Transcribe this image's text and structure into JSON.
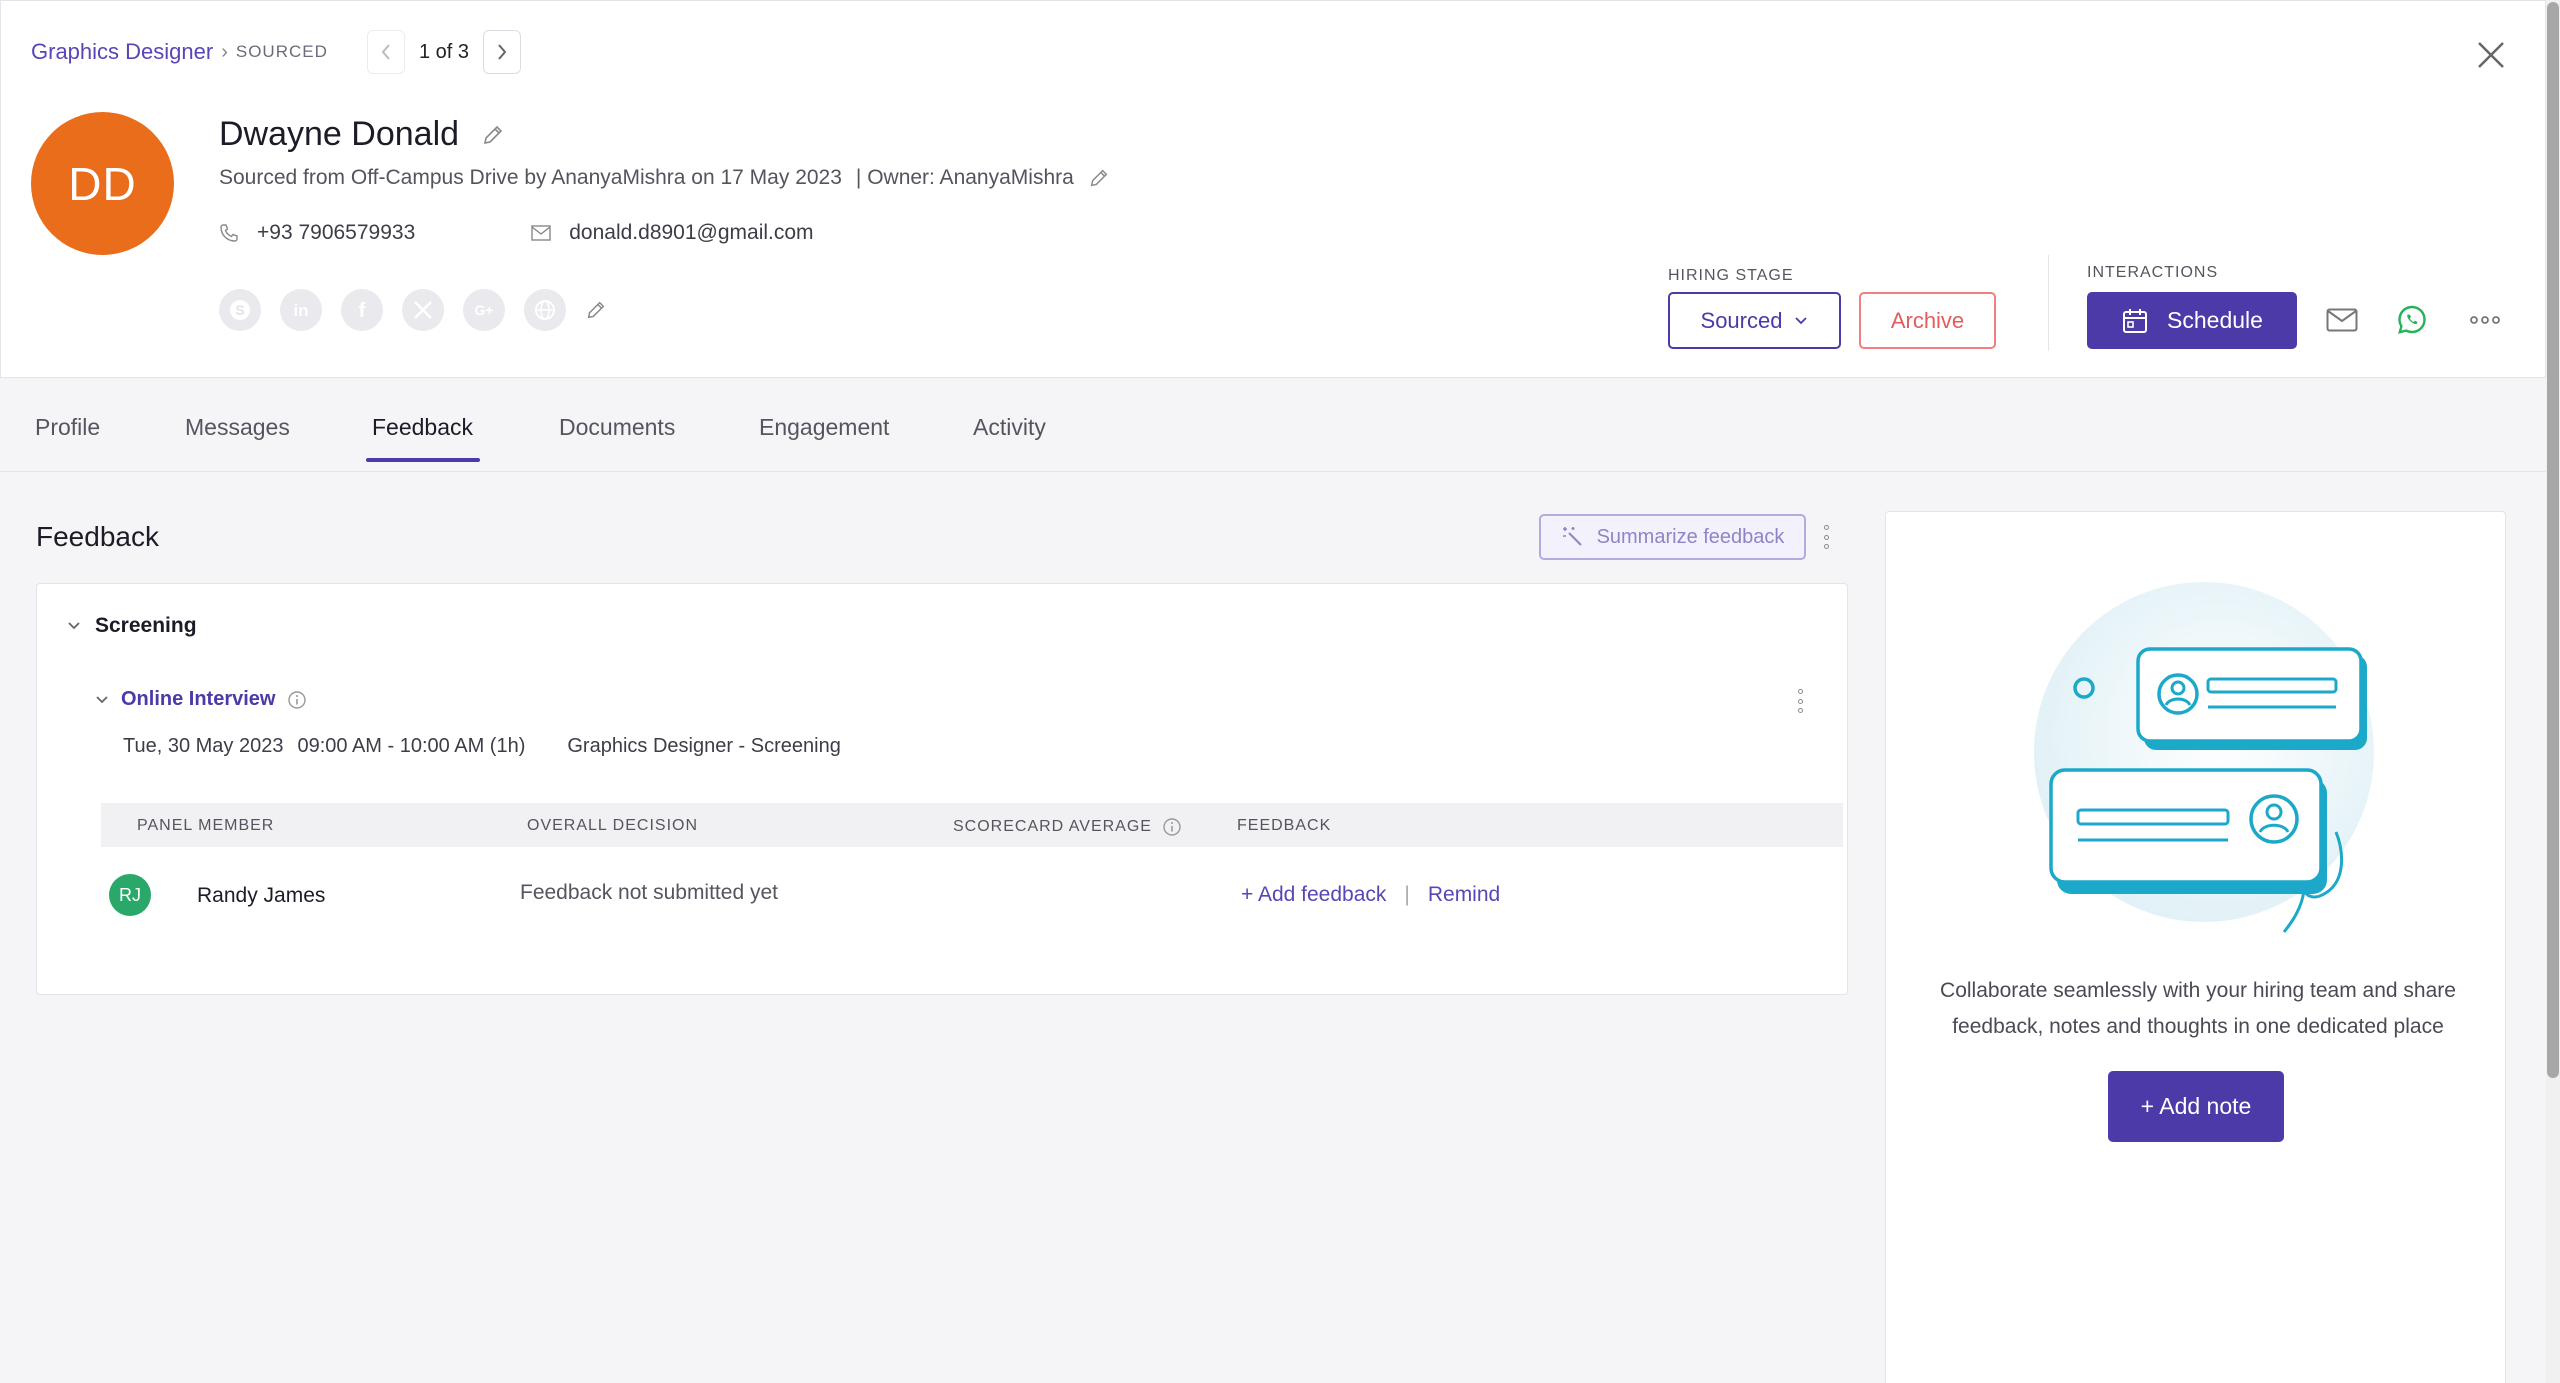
{
  "breadcrumb": {
    "job": "Graphics Designer",
    "stage": "SOURCED"
  },
  "pager": {
    "text": "1 of 3"
  },
  "candidate": {
    "initials": "DD",
    "name": "Dwayne Donald",
    "sourced_info": "Sourced from Off-Campus Drive by AnanyaMishra on 17 May 2023",
    "owner_info": "| Owner: AnanyaMishra",
    "phone": "+93 7906579933",
    "email": "donald.d8901@gmail.com",
    "avatar_color": "#ea6d1c"
  },
  "social": [
    "skype-icon",
    "linkedin-icon",
    "facebook-icon",
    "x-icon",
    "google-plus-icon",
    "website-icon"
  ],
  "hiring_stage": {
    "label": "HIRING STAGE",
    "value": "Sourced",
    "archive_label": "Archive"
  },
  "interactions": {
    "label": "INTERACTIONS",
    "schedule_label": "Schedule"
  },
  "tabs": [
    {
      "label": "Profile"
    },
    {
      "label": "Messages"
    },
    {
      "label": "Feedback",
      "active": true
    },
    {
      "label": "Documents"
    },
    {
      "label": "Engagement"
    },
    {
      "label": "Activity"
    }
  ],
  "feedback": {
    "title": "Feedback",
    "summarize_label": "Summarize feedback",
    "section_label": "Screening",
    "interview": {
      "title": "Online Interview",
      "date": "Tue, 30 May 2023",
      "time": "09:00 AM - 10:00 AM (1h)",
      "location": "Graphics Designer - Screening"
    },
    "table": {
      "headers": [
        "PANEL MEMBER",
        "OVERALL DECISION",
        "SCORECARD AVERAGE",
        "FEEDBACK"
      ],
      "rows": [
        {
          "initials": "RJ",
          "name": "Randy James",
          "decision": "Feedback not submitted yet",
          "add_feedback": "+ Add feedback",
          "separator": "|",
          "remind": "Remind"
        }
      ]
    }
  },
  "notes": {
    "line1": "Collaborate seamlessly with your hiring team and share",
    "line2": "feedback, notes and thoughts in one dedicated place",
    "add_note_label": "+ Add note"
  },
  "colors": {
    "primary": "#4b3aa8",
    "archive": "#e55c5c",
    "whatsapp": "#25b35a",
    "rj_avatar": "#2aa86a"
  }
}
